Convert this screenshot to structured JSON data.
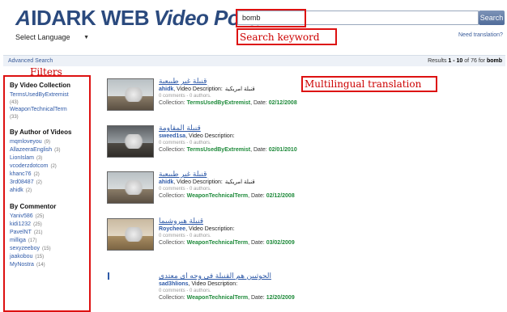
{
  "header": {
    "logo_mark": "A",
    "logo_name": "IDARK WEB",
    "logo_suffix": "Video Portal",
    "language_select": "Select Language",
    "search_value": "bomb",
    "search_button": "Search",
    "need_translation": "Need translation?"
  },
  "annotations": {
    "search_keyword": "Search keyword",
    "filters": "Filters",
    "translation": "Multilingual translation"
  },
  "info_bar": {
    "advanced_search": "Advanced Search",
    "results_prefix": "Results",
    "results_range": "1 - 10",
    "results_of": "of",
    "results_total": "76",
    "results_for": "for",
    "results_query": "bomb"
  },
  "filters": {
    "collection_title": "By Video Collection",
    "collections": [
      {
        "name": "TermsUsedByExtremist",
        "count": "(43)"
      },
      {
        "name": "WeaponTechnicalTerm",
        "count": "(33)"
      }
    ],
    "author_title": "By Author of Videos",
    "authors": [
      {
        "name": "mqmloveyou",
        "count": "(9)"
      },
      {
        "name": "AllazeeraEnglish",
        "count": "(3)"
      },
      {
        "name": "LionIslam",
        "count": "(3)"
      },
      {
        "name": "vcoderzdotcom",
        "count": "(2)"
      },
      {
        "name": "khanc76",
        "count": "(2)"
      },
      {
        "name": "3rd08487",
        "count": "(2)"
      },
      {
        "name": "ahidk",
        "count": "(2)"
      }
    ],
    "commentor_title": "By Commentor",
    "commentors": [
      {
        "name": "Yaniv586",
        "count": "(25)"
      },
      {
        "name": "kidi1232",
        "count": "(25)"
      },
      {
        "name": "PavelNT",
        "count": "(21)"
      },
      {
        "name": "milliga",
        "count": "(17)"
      },
      {
        "name": "sexyzeeboy",
        "count": "(15)"
      },
      {
        "name": "jaakobou",
        "count": "(15)"
      },
      {
        "name": "MyNostra",
        "count": "(14)"
      }
    ]
  },
  "results": [
    {
      "title": "قنبلة غير طبيعية",
      "uploader": "ahidk",
      "desc_label": ", Video Description:",
      "arabic_desc": "قنبلة امريكية",
      "comments": "0 comments - 0 authors.",
      "collection_label": "Collection:",
      "collection": "TermsUsedByExtremist",
      "date_label": ", Date:",
      "date": "02/12/2008"
    },
    {
      "title": "قنبلة المقاومة",
      "uploader": "sweed1sa",
      "desc_label": ", Video Description:",
      "arabic_desc": "",
      "comments": "0 comments - 0 authors.",
      "collection_label": "Collection:",
      "collection": "TermsUsedByExtremist",
      "date_label": ", Date:",
      "date": "02/01/2010"
    },
    {
      "title": "قنبلة غير طبيعية",
      "uploader": "ahidk",
      "desc_label": ", Video Description:",
      "arabic_desc": "قنبلة امريكية",
      "comments": "0 comments - 0 authors.",
      "collection_label": "Collection:",
      "collection": "WeaponTechnicalTerm",
      "date_label": ", Date:",
      "date": "02/12/2008"
    },
    {
      "title": "قنبلة هيروشيما",
      "uploader": "Roycheee",
      "desc_label": ", Video Description:",
      "arabic_desc": "",
      "comments": "0 comments - 0 authors.",
      "collection_label": "Collection:",
      "collection": "WeaponTechnicalTerm",
      "date_label": ", Date:",
      "date": "03/02/2009"
    },
    {
      "title": "الحوثيين هم القنبلة في وجه اي معتدي",
      "uploader": "sad3hlions",
      "desc_label": ", Video Description:",
      "arabic_desc": "",
      "comments": "0 comments - 0 authors.",
      "collection_label": "Collection:",
      "collection": "WeaponTechnicalTerm",
      "date_label": ", Date:",
      "date": "12/20/2009"
    }
  ],
  "colors": {
    "annotation_red": "#dd1111",
    "link_blue": "#2f5aa8",
    "collection_green": "#1e8a3a",
    "logo_blue": "#2b4a7e"
  }
}
